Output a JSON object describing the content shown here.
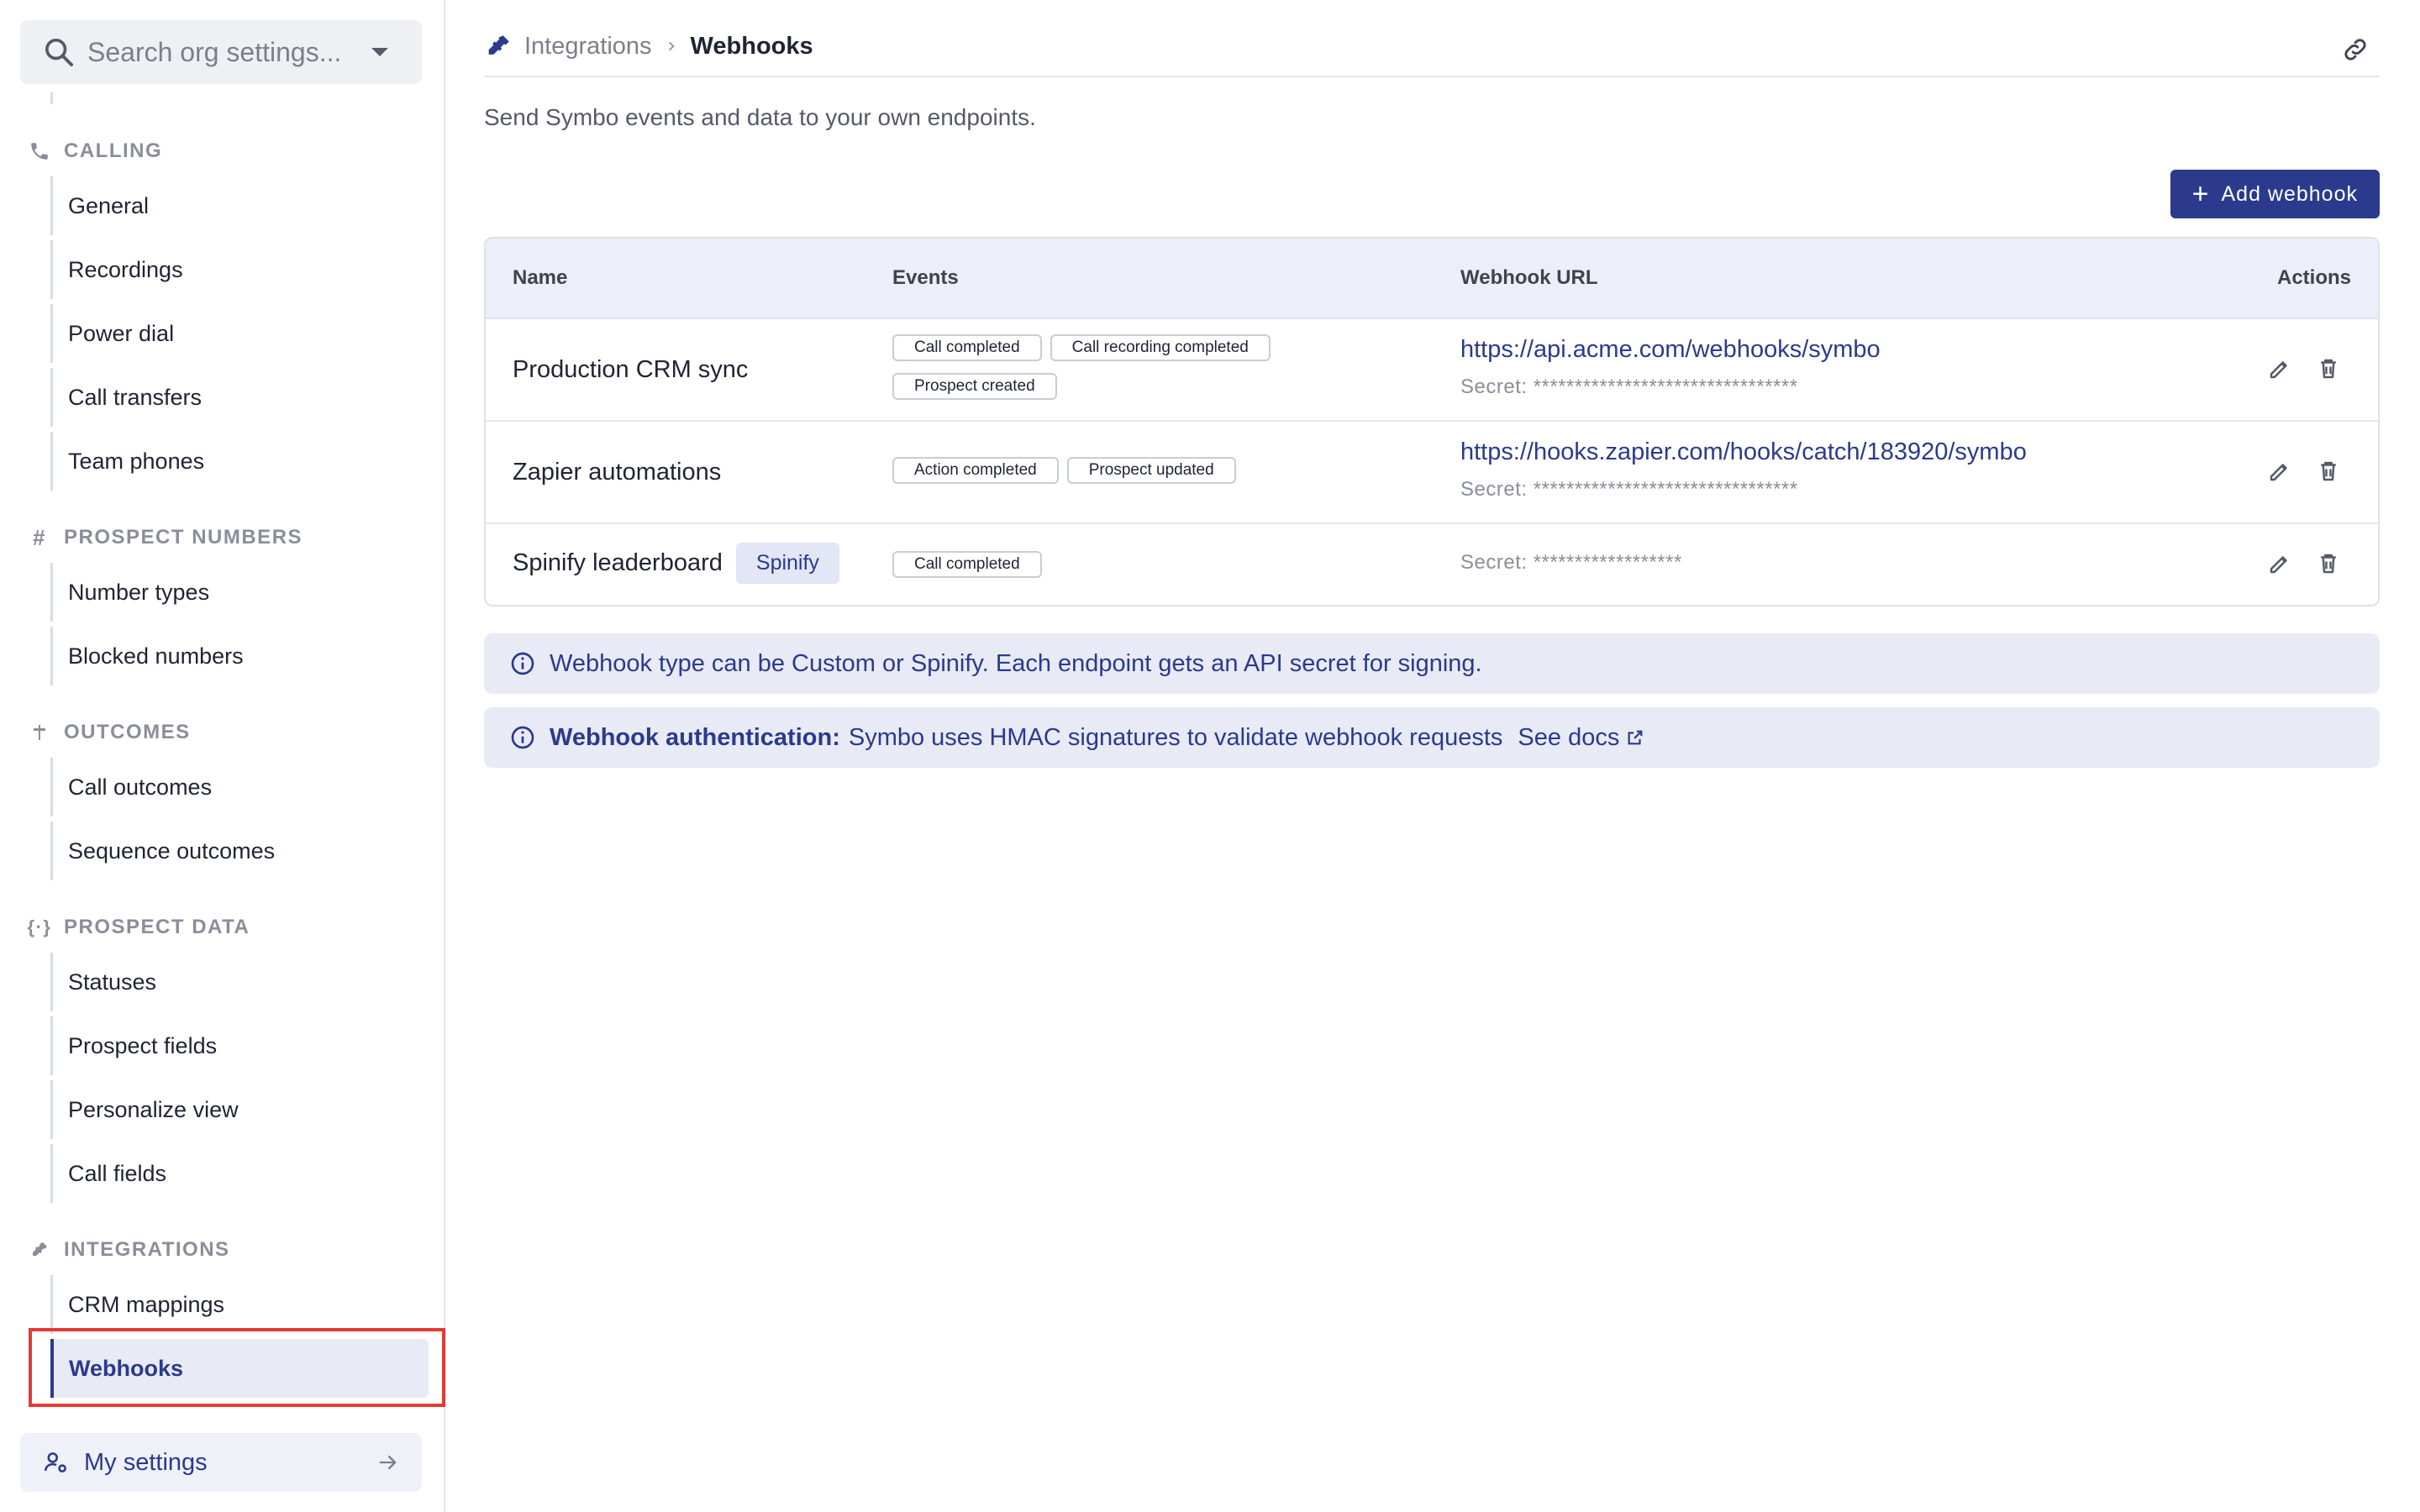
{
  "sidebar": {
    "search": {
      "placeholder": "Search org settings..."
    },
    "sections": [
      {
        "title": "CALLING",
        "icon": "phone-icon",
        "items": [
          "General",
          "Recordings",
          "Power dial",
          "Call transfers",
          "Team phones"
        ]
      },
      {
        "title": "PROSPECT NUMBERS",
        "icon": "hash-icon",
        "items": [
          "Number types",
          "Blocked numbers"
        ]
      },
      {
        "title": "OUTCOMES",
        "icon": "signpost-icon",
        "items": [
          "Call outcomes",
          "Sequence outcomes"
        ]
      },
      {
        "title": "PROSPECT DATA",
        "icon": "braces-icon",
        "items": [
          "Statuses",
          "Prospect fields",
          "Personalize view",
          "Call fields"
        ]
      },
      {
        "title": "INTEGRATIONS",
        "icon": "plug-icon",
        "items": [
          "CRM mappings",
          "Webhooks"
        ]
      }
    ],
    "active_item": "Webhooks",
    "my_settings": "My settings"
  },
  "header": {
    "breadcrumb_parent": "Integrations",
    "breadcrumb_current": "Webhooks",
    "subtitle": "Send Symbo events and data to your own endpoints."
  },
  "toolbar": {
    "add_label": "Add webhook"
  },
  "table": {
    "columns": [
      "Name",
      "Events",
      "Webhook URL",
      "Actions"
    ],
    "rows": [
      {
        "name": "Production CRM sync",
        "badge": "",
        "events": [
          "Call completed",
          "Call recording completed",
          "Prospect created"
        ],
        "url": "https://api.acme.com/webhooks/symbo",
        "secret": "Secret: ********************************"
      },
      {
        "name": "Zapier automations",
        "badge": "",
        "events": [
          "Action completed",
          "Prospect updated"
        ],
        "url": "https://hooks.zapier.com/hooks/catch/183920/symbo",
        "secret": "Secret: ********************************"
      },
      {
        "name": "Spinify leaderboard",
        "badge": "Spinify",
        "events": [
          "Call completed"
        ],
        "url": "",
        "secret": "Secret: ******************"
      }
    ]
  },
  "banners": {
    "type_info": "Webhook type can be Custom or Spinify. Each endpoint gets an API secret for signing.",
    "auth_title": "Webhook authentication:",
    "auth_text": "Symbo uses HMAC signatures to validate webhook requests",
    "auth_link": "See docs"
  },
  "colors": {
    "accent": "#2b3a8c",
    "highlight": "#e53935",
    "banner_bg": "#e8eaf6"
  }
}
